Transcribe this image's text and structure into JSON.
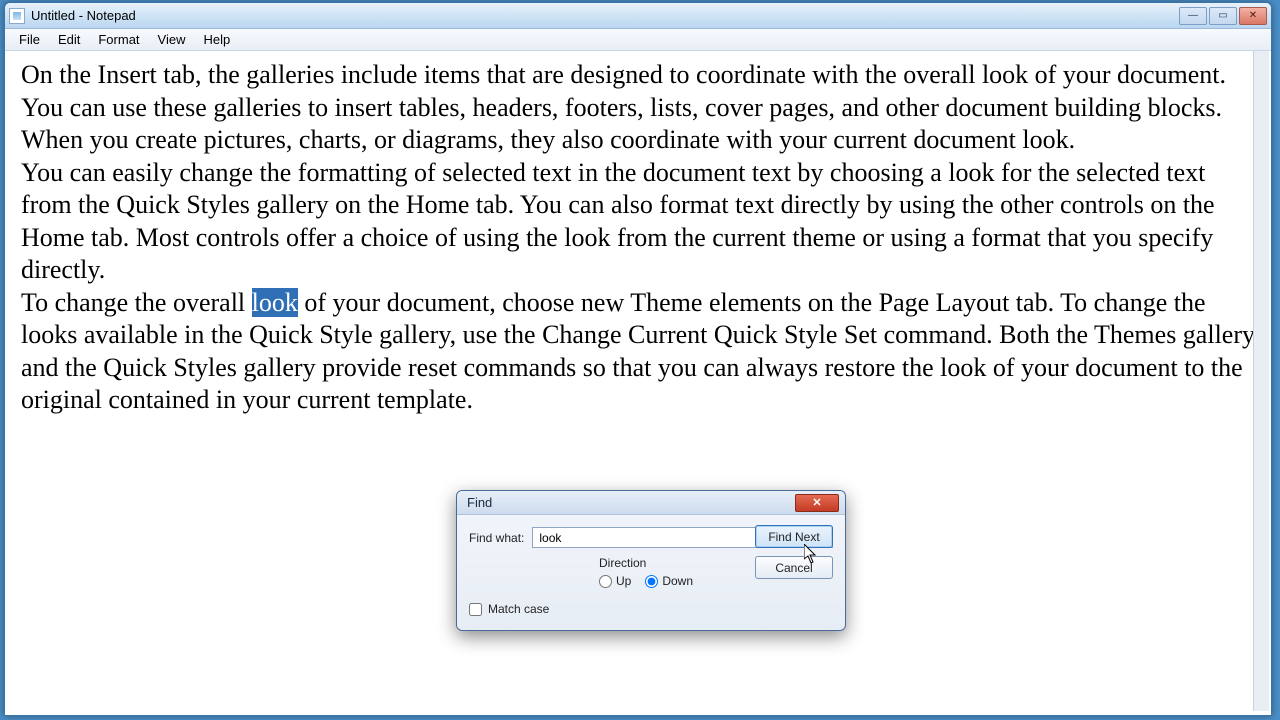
{
  "window": {
    "title": "Untitled - Notepad"
  },
  "menubar": {
    "file": "File",
    "edit": "Edit",
    "format": "Format",
    "view": "View",
    "help": "Help"
  },
  "editor": {
    "p1a": "On the Insert tab, the galleries include items that are designed to coordinate with the overall look of your document. You can use these galleries to insert tables, headers, footers, lists, cover pages, and other document building blocks. When you create pictures, charts, or diagrams, they also coordinate with your current document look.",
    "p2a": "You can easily change the formatting of selected text in the document text by choosing a look for the selected text from the Quick Styles gallery on the Home tab. You can also format text directly by using the other controls on the Home tab. Most controls offer a choice of using the look from the current theme or using a format that you specify directly.",
    "p3a": "To change the overall ",
    "p3hl": "look",
    "p3b": " of your document, choose new Theme elements on the Page Layout tab. To change the looks available in the Quick Style gallery, use the Change Current Quick Style Set command. Both the Themes gallery and the Quick Styles gallery provide reset commands so that you can always restore the look of your document to the original contained in your current template."
  },
  "find_dialog": {
    "title": "Find",
    "find_what_label": "Find what:",
    "find_what_value": "look",
    "find_next": "Find Next",
    "cancel": "Cancel",
    "direction_label": "Direction",
    "up": "Up",
    "down": "Down",
    "direction_selected": "down",
    "match_case": "Match case",
    "match_case_checked": false
  }
}
